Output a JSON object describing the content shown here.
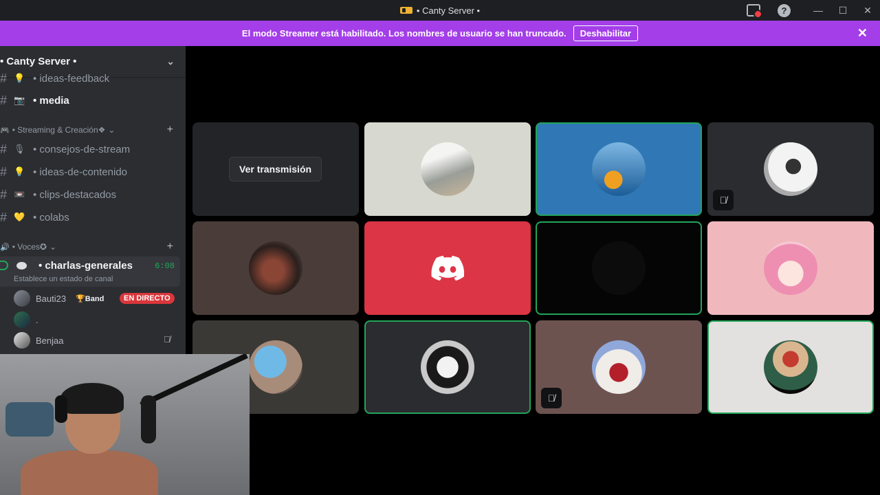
{
  "titlebar": {
    "title": "• Canty Server •"
  },
  "banner": {
    "message": "El modo Streamer está habilitado. Los nombres de usuario se han truncado.",
    "button_label": "Deshabilitar"
  },
  "sidebar": {
    "server_name": "• Canty Server •",
    "channels_top": [
      {
        "emoji": "💡",
        "label": "• ideas-feedback"
      },
      {
        "emoji": "📷",
        "label": "• media"
      }
    ],
    "category_streaming": "• Streaming & Creación❖",
    "streaming_channels": [
      {
        "emoji": "🎙",
        "label": "• consejos-de-stream"
      },
      {
        "emoji": "💡",
        "label": "• ideas-de-contenido"
      },
      {
        "emoji": "📼",
        "label": "• clips-destacados"
      },
      {
        "emoji": "💛",
        "label": "• colabs"
      }
    ],
    "category_voice": "• Voces✪",
    "voice_channel": {
      "label": "• charlas-generales",
      "time": "6:08",
      "status": "Establece un estado de canal"
    },
    "members": [
      {
        "name": "Bauti23",
        "badge": "🏆Band",
        "live": "EN DIRECTO"
      },
      {
        "name": "."
      },
      {
        "name": "Benjaa"
      }
    ]
  },
  "grid": {
    "watch_label": "Ver transmisión"
  },
  "colors": {
    "banner": "#a33ee8",
    "speaking": "#23a559",
    "live": "#da373c",
    "discord_red": "#dc3545"
  }
}
